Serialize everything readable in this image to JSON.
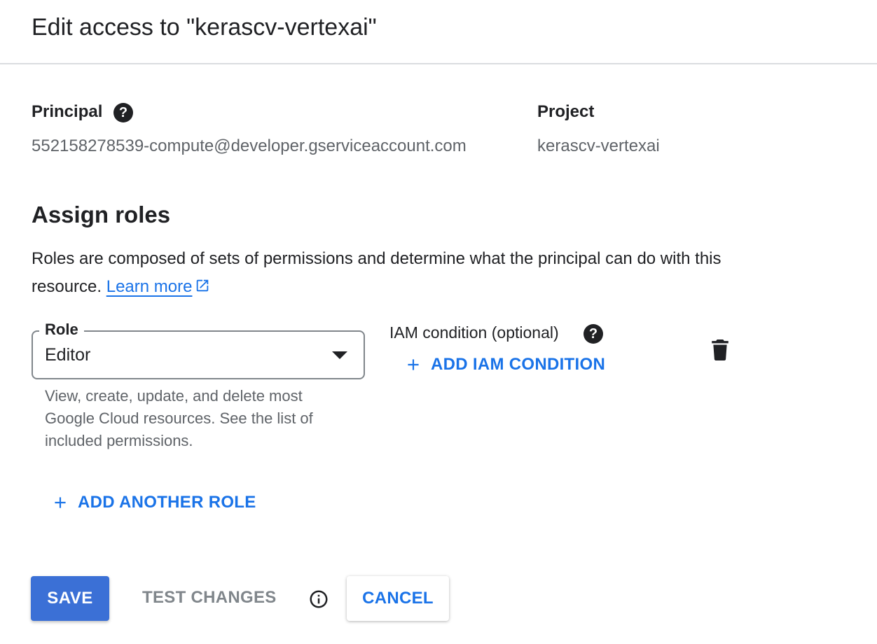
{
  "dialog": {
    "title": "Edit access to \"kerascv-vertexai\""
  },
  "principal": {
    "label": "Principal",
    "help_icon": "help-icon",
    "value": "552158278539-compute@developer.gserviceaccount.com"
  },
  "project": {
    "label": "Project",
    "value": "kerascv-vertexai"
  },
  "assign_roles": {
    "title": "Assign roles",
    "description": "Roles are composed of sets of permissions and determine what the principal can do with this resource.",
    "learn_more": "Learn more"
  },
  "role_field": {
    "label": "Role",
    "value": "Editor",
    "help_text": "View, create, update, and delete most Google Cloud resources. See the list of included permissions."
  },
  "iam_condition": {
    "label": "IAM condition (optional)",
    "add_label": "ADD IAM CONDITION"
  },
  "add_another_role": "ADD ANOTHER ROLE",
  "actions": {
    "save": "SAVE",
    "test_changes": "TEST CHANGES",
    "cancel": "CANCEL"
  },
  "colors": {
    "primary_blue": "#1a73e8",
    "save_button": "#3b70d6",
    "disabled_text": "#80868b"
  },
  "icons": {
    "help": "help-icon",
    "external_link": "external-link-icon",
    "dropdown": "chevron-down-icon",
    "plus": "plus-icon",
    "delete": "trash-icon",
    "info": "info-icon"
  }
}
